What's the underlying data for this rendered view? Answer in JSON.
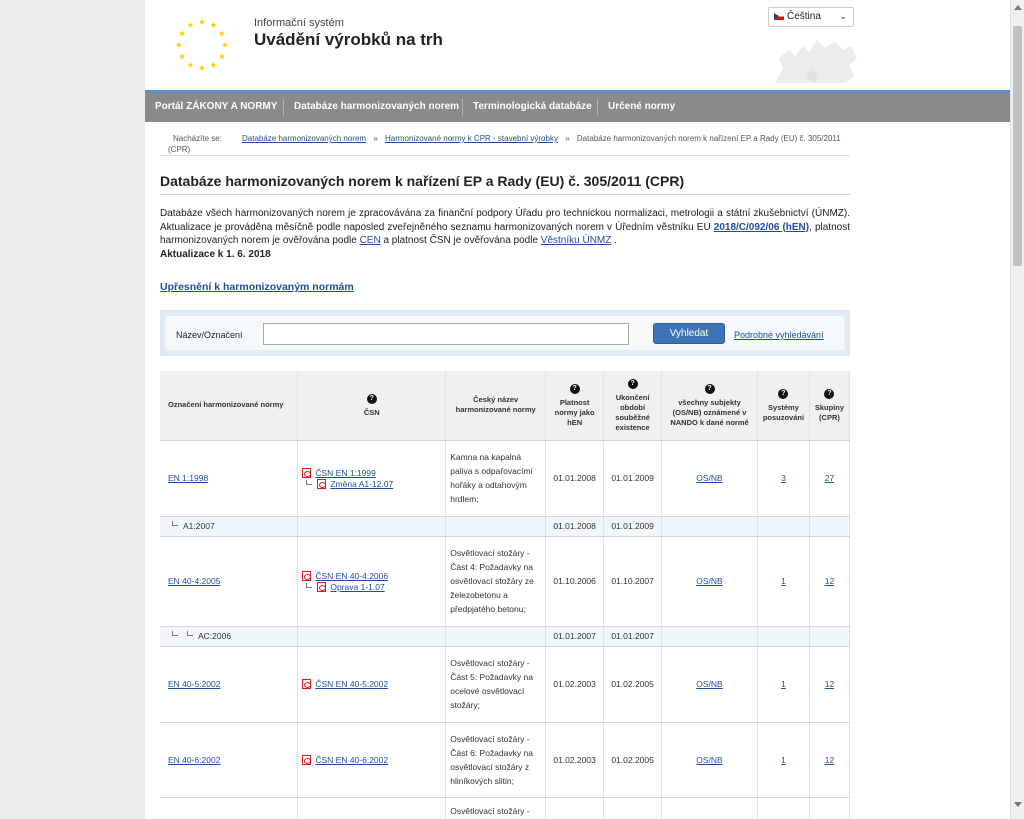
{
  "header": {
    "system_subtitle": "Informační systém",
    "system_title": "Uvádění výrobků na trh",
    "language": "Čeština"
  },
  "nav": {
    "items": [
      {
        "label": "Portál ZÁKONY A NORMY"
      },
      {
        "label": "Databáze harmonizovaných norem"
      },
      {
        "label": "Terminologická databáze"
      },
      {
        "label": "Určené normy"
      }
    ]
  },
  "breadcrumb": {
    "label": "Nacházíte se:",
    "items": [
      "Databáze harmonizovaných norem",
      "Harmonizované normy k CPR - stavební výrobky",
      "Databáze harmonizovaných norem k nařízení EP a Rady (EU) č. 305/2011"
    ],
    "tail": "(CPR)",
    "separator": "»"
  },
  "main": {
    "title": "Databáze harmonizovaných norem k nařízení EP a Rady (EU) č. 305/2011 (CPR)",
    "intro_part1": "Databáze všech harmonizovaných norem je zpracovávána za finanční podpory Úřadu pro technickou normalizaci, metrologii a státní zkušebnictví (ÚNMZ). Aktualizace je prováděna měsíčně podle naposled zveřejněného seznamu harmonizovaných norem v Úředním věstníku EU ",
    "intro_link_oj": "2018/C/092/06 (hEN)",
    "intro_part2": ", platnost harmonizovaných norem je ověřována podle ",
    "intro_link_cen": "CEN",
    "intro_part3": " a platnost ČSN je ověřována podle ",
    "intro_link_vestnik": "Věstníku ÚNMZ",
    "intro_part4": " .",
    "updated": "Aktualizace k 1. 6. 2018",
    "refine_link": "Upřesnění k harmonizovaným normám"
  },
  "search": {
    "label": "Název/Označení",
    "value": "",
    "placeholder": "",
    "button": "Vyhledat",
    "advanced": "Podrobné vyhledávání"
  },
  "table": {
    "help_glyph": "?",
    "headers": {
      "designation": "Označení harmonizované normy",
      "csn": "ČSN",
      "czech_name": "Český název harmonizované normy",
      "validity": "Platnost normy jako hEN",
      "coexistence_end": "Ukončení období souběžné existence",
      "bodies": "všechny subjekty (OS/NB) oznámené v NANDO k dané normě",
      "systems": "Systémy posuzování",
      "groups": "Skupiny (CPR)"
    },
    "rows": [
      {
        "designation": "EN 1:1998",
        "csn": [
          "ČSN EN 1:1999",
          "Změna A1-12.07"
        ],
        "name": "Kamna na kapalná paliva s odpařovacími hořáky a odtahovým hrdlem;",
        "validity": "01.01.2008",
        "end": "01.01.2009",
        "bodies": "OS/NB",
        "systems": "3",
        "groups": "27"
      },
      {
        "designation": "A1:2007",
        "validity": "01.01.2008",
        "end": "01.01.2009"
      },
      {
        "designation": "EN 40-4:2005",
        "csn": [
          "ČSN EN 40-4:2006",
          "Oprava 1-1.07"
        ],
        "name": "Osvětlovací stožáry - Část 4: Požadavky na osvětlovací stožáry ze železobetonu a předpjatého betonu;",
        "validity": "01.10.2006",
        "end": "01.10.2007",
        "bodies": "OS/NB",
        "systems": "1",
        "groups": "12"
      },
      {
        "designation": "AC:2006",
        "validity": "01.01.2007",
        "end": "01.01.2007"
      },
      {
        "designation": "EN 40-5:2002",
        "csn": [
          "ČSN EN 40-5:2002"
        ],
        "name": "Osvětlovací stožáry - Část 5: Požadavky na ocelové osvětlovací stožáry;",
        "validity": "01.02.2003",
        "end": "01.02.2005",
        "bodies": "OS/NB",
        "systems": "1",
        "groups": "12"
      },
      {
        "designation": "EN 40-6:2002",
        "csn": [
          "ČSN EN 40-6:2002"
        ],
        "name": "Osvětlovací stožáry - Část 6: Požadavky na osvětlovací stožáry z hliníkových slitin;",
        "validity": "01.02.2003",
        "end": "01.02.2005",
        "bodies": "OS/NB",
        "systems": "1",
        "groups": "12"
      },
      {
        "name": "Osvětlovací stožáry -"
      }
    ]
  },
  "colors": {
    "nav_bg": "#8a8a8a",
    "nav_accent": "#5f8fc6",
    "link": "#1f4e9c",
    "button": "#3d74b5",
    "eu_star": "#ffcc00"
  }
}
